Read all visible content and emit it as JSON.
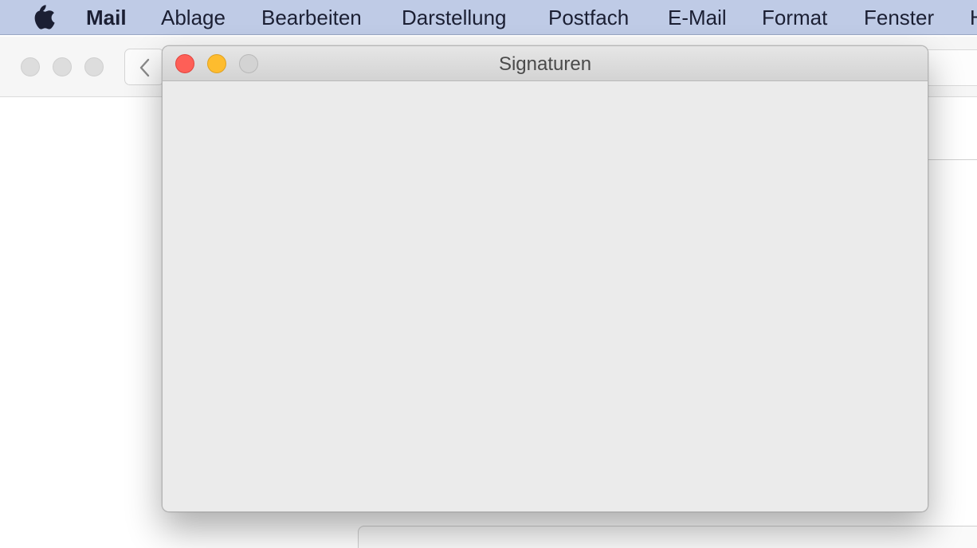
{
  "menubar": {
    "apple_icon": "apple-logo-icon",
    "app_name": "Mail",
    "items": [
      "Ablage",
      "Bearbeiten",
      "Darstellung",
      "Postfach",
      "E-Mail",
      "Format",
      "Fenster",
      "H"
    ]
  },
  "background_window": {
    "back_icon": "chevron-left-icon"
  },
  "dialog": {
    "title": "Signaturen"
  },
  "colors": {
    "menubar": "#bfcbe6",
    "close": "#fe5f57",
    "minimize": "#febc2e",
    "zoom_disabled": "#d3d3d3",
    "dialog_bg": "#ececec"
  }
}
